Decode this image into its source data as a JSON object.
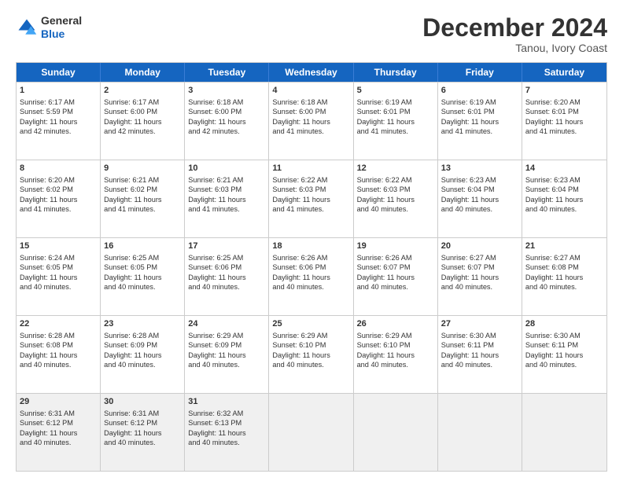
{
  "header": {
    "logo_line1": "General",
    "logo_line2": "Blue",
    "month_title": "December 2024",
    "location": "Tanou, Ivory Coast"
  },
  "days_of_week": [
    "Sunday",
    "Monday",
    "Tuesday",
    "Wednesday",
    "Thursday",
    "Friday",
    "Saturday"
  ],
  "weeks": [
    [
      {
        "day": "1",
        "lines": [
          "Sunrise: 6:17 AM",
          "Sunset: 5:59 PM",
          "Daylight: 11 hours",
          "and 42 minutes."
        ]
      },
      {
        "day": "2",
        "lines": [
          "Sunrise: 6:17 AM",
          "Sunset: 6:00 PM",
          "Daylight: 11 hours",
          "and 42 minutes."
        ]
      },
      {
        "day": "3",
        "lines": [
          "Sunrise: 6:18 AM",
          "Sunset: 6:00 PM",
          "Daylight: 11 hours",
          "and 42 minutes."
        ]
      },
      {
        "day": "4",
        "lines": [
          "Sunrise: 6:18 AM",
          "Sunset: 6:00 PM",
          "Daylight: 11 hours",
          "and 41 minutes."
        ]
      },
      {
        "day": "5",
        "lines": [
          "Sunrise: 6:19 AM",
          "Sunset: 6:01 PM",
          "Daylight: 11 hours",
          "and 41 minutes."
        ]
      },
      {
        "day": "6",
        "lines": [
          "Sunrise: 6:19 AM",
          "Sunset: 6:01 PM",
          "Daylight: 11 hours",
          "and 41 minutes."
        ]
      },
      {
        "day": "7",
        "lines": [
          "Sunrise: 6:20 AM",
          "Sunset: 6:01 PM",
          "Daylight: 11 hours",
          "and 41 minutes."
        ]
      }
    ],
    [
      {
        "day": "8",
        "lines": [
          "Sunrise: 6:20 AM",
          "Sunset: 6:02 PM",
          "Daylight: 11 hours",
          "and 41 minutes."
        ]
      },
      {
        "day": "9",
        "lines": [
          "Sunrise: 6:21 AM",
          "Sunset: 6:02 PM",
          "Daylight: 11 hours",
          "and 41 minutes."
        ]
      },
      {
        "day": "10",
        "lines": [
          "Sunrise: 6:21 AM",
          "Sunset: 6:03 PM",
          "Daylight: 11 hours",
          "and 41 minutes."
        ]
      },
      {
        "day": "11",
        "lines": [
          "Sunrise: 6:22 AM",
          "Sunset: 6:03 PM",
          "Daylight: 11 hours",
          "and 41 minutes."
        ]
      },
      {
        "day": "12",
        "lines": [
          "Sunrise: 6:22 AM",
          "Sunset: 6:03 PM",
          "Daylight: 11 hours",
          "and 40 minutes."
        ]
      },
      {
        "day": "13",
        "lines": [
          "Sunrise: 6:23 AM",
          "Sunset: 6:04 PM",
          "Daylight: 11 hours",
          "and 40 minutes."
        ]
      },
      {
        "day": "14",
        "lines": [
          "Sunrise: 6:23 AM",
          "Sunset: 6:04 PM",
          "Daylight: 11 hours",
          "and 40 minutes."
        ]
      }
    ],
    [
      {
        "day": "15",
        "lines": [
          "Sunrise: 6:24 AM",
          "Sunset: 6:05 PM",
          "Daylight: 11 hours",
          "and 40 minutes."
        ]
      },
      {
        "day": "16",
        "lines": [
          "Sunrise: 6:25 AM",
          "Sunset: 6:05 PM",
          "Daylight: 11 hours",
          "and 40 minutes."
        ]
      },
      {
        "day": "17",
        "lines": [
          "Sunrise: 6:25 AM",
          "Sunset: 6:06 PM",
          "Daylight: 11 hours",
          "and 40 minutes."
        ]
      },
      {
        "day": "18",
        "lines": [
          "Sunrise: 6:26 AM",
          "Sunset: 6:06 PM",
          "Daylight: 11 hours",
          "and 40 minutes."
        ]
      },
      {
        "day": "19",
        "lines": [
          "Sunrise: 6:26 AM",
          "Sunset: 6:07 PM",
          "Daylight: 11 hours",
          "and 40 minutes."
        ]
      },
      {
        "day": "20",
        "lines": [
          "Sunrise: 6:27 AM",
          "Sunset: 6:07 PM",
          "Daylight: 11 hours",
          "and 40 minutes."
        ]
      },
      {
        "day": "21",
        "lines": [
          "Sunrise: 6:27 AM",
          "Sunset: 6:08 PM",
          "Daylight: 11 hours",
          "and 40 minutes."
        ]
      }
    ],
    [
      {
        "day": "22",
        "lines": [
          "Sunrise: 6:28 AM",
          "Sunset: 6:08 PM",
          "Daylight: 11 hours",
          "and 40 minutes."
        ]
      },
      {
        "day": "23",
        "lines": [
          "Sunrise: 6:28 AM",
          "Sunset: 6:09 PM",
          "Daylight: 11 hours",
          "and 40 minutes."
        ]
      },
      {
        "day": "24",
        "lines": [
          "Sunrise: 6:29 AM",
          "Sunset: 6:09 PM",
          "Daylight: 11 hours",
          "and 40 minutes."
        ]
      },
      {
        "day": "25",
        "lines": [
          "Sunrise: 6:29 AM",
          "Sunset: 6:10 PM",
          "Daylight: 11 hours",
          "and 40 minutes."
        ]
      },
      {
        "day": "26",
        "lines": [
          "Sunrise: 6:29 AM",
          "Sunset: 6:10 PM",
          "Daylight: 11 hours",
          "and 40 minutes."
        ]
      },
      {
        "day": "27",
        "lines": [
          "Sunrise: 6:30 AM",
          "Sunset: 6:11 PM",
          "Daylight: 11 hours",
          "and 40 minutes."
        ]
      },
      {
        "day": "28",
        "lines": [
          "Sunrise: 6:30 AM",
          "Sunset: 6:11 PM",
          "Daylight: 11 hours",
          "and 40 minutes."
        ]
      }
    ],
    [
      {
        "day": "29",
        "lines": [
          "Sunrise: 6:31 AM",
          "Sunset: 6:12 PM",
          "Daylight: 11 hours",
          "and 40 minutes."
        ]
      },
      {
        "day": "30",
        "lines": [
          "Sunrise: 6:31 AM",
          "Sunset: 6:12 PM",
          "Daylight: 11 hours",
          "and 40 minutes."
        ]
      },
      {
        "day": "31",
        "lines": [
          "Sunrise: 6:32 AM",
          "Sunset: 6:13 PM",
          "Daylight: 11 hours",
          "and 40 minutes."
        ]
      },
      {
        "day": "",
        "lines": []
      },
      {
        "day": "",
        "lines": []
      },
      {
        "day": "",
        "lines": []
      },
      {
        "day": "",
        "lines": []
      }
    ]
  ]
}
